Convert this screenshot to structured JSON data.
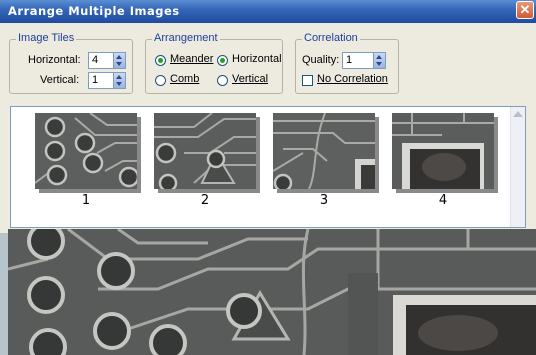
{
  "window": {
    "title": "Arrange Multiple Images",
    "close_symbol": "✕"
  },
  "image_tiles": {
    "legend": "Image Tiles",
    "horizontal_label": "Horizontal:",
    "horizontal_value": "4",
    "vertical_label": "Vertical:",
    "vertical_value": "1"
  },
  "arrangement": {
    "legend": "Arrangement",
    "meander_label": "Meander",
    "comb_label": "Comb",
    "horizontal_label": "Horizontal",
    "vertical_label": "Vertical",
    "selected_pattern": "Meander",
    "selected_direction": "Horizontal"
  },
  "correlation": {
    "legend": "Correlation",
    "quality_label": "Quality:",
    "quality_value": "1",
    "no_correlation_label": "No Correlation",
    "no_correlation_checked": false
  },
  "thumbnails": [
    {
      "number": "1"
    },
    {
      "number": "2"
    },
    {
      "number": "3"
    },
    {
      "number": "4"
    }
  ],
  "colors": {
    "title_bar": "#2a5ab0",
    "dialog_bg": "#edeae0",
    "legend_text": "#1e3f9a"
  }
}
